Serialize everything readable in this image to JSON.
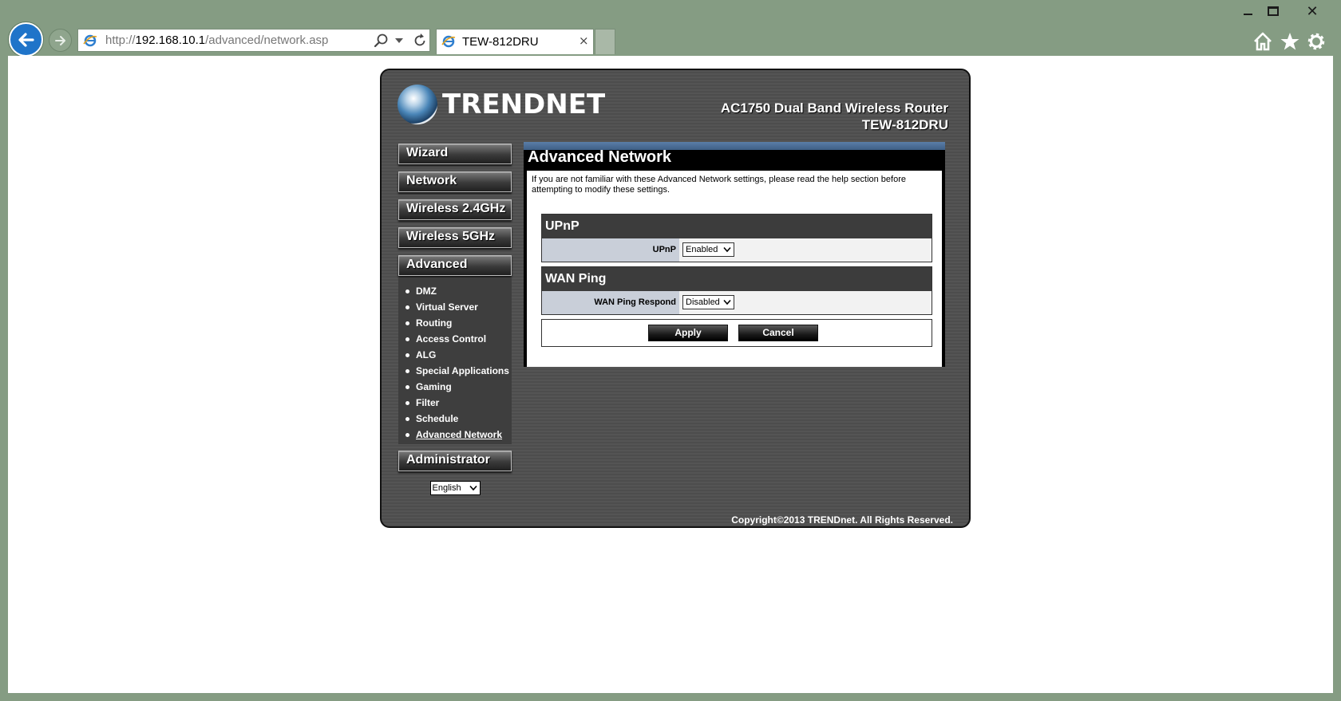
{
  "browser": {
    "address": {
      "prefix": "http://",
      "host": "192.168.10.1",
      "path": "/advanced/network.asp"
    },
    "tab_title": "TEW-812DRU",
    "tab_close": "×",
    "window_close": "✕"
  },
  "router": {
    "brand": "TRENDNET",
    "product_line": "AC1750 Dual Band Wireless Router",
    "model": "TEW-812DRU",
    "copyright": "Copyright©2013 TRENDnet. All Rights Reserved."
  },
  "sidebar": {
    "menu": [
      "Wizard",
      "Network",
      "Wireless 2.4GHz",
      "Wireless 5GHz",
      "Advanced"
    ],
    "submenu": [
      "DMZ",
      "Virtual Server",
      "Routing",
      "Access Control",
      "ALG",
      "Special Applications",
      "Gaming",
      "Filter",
      "Schedule",
      "Advanced Network"
    ],
    "admin": "Administrator",
    "language": "English"
  },
  "content": {
    "title": "Advanced Network",
    "intro": "If you are not familiar with these Advanced Network settings, please read the help section before attempting to modify these settings.",
    "upnp": {
      "heading": "UPnP",
      "label": "UPnP",
      "value": "Enabled"
    },
    "wan_ping": {
      "heading": "WAN Ping",
      "label": "WAN Ping Respond",
      "value": "Disabled"
    },
    "apply_label": "Apply",
    "cancel_label": "Cancel"
  }
}
